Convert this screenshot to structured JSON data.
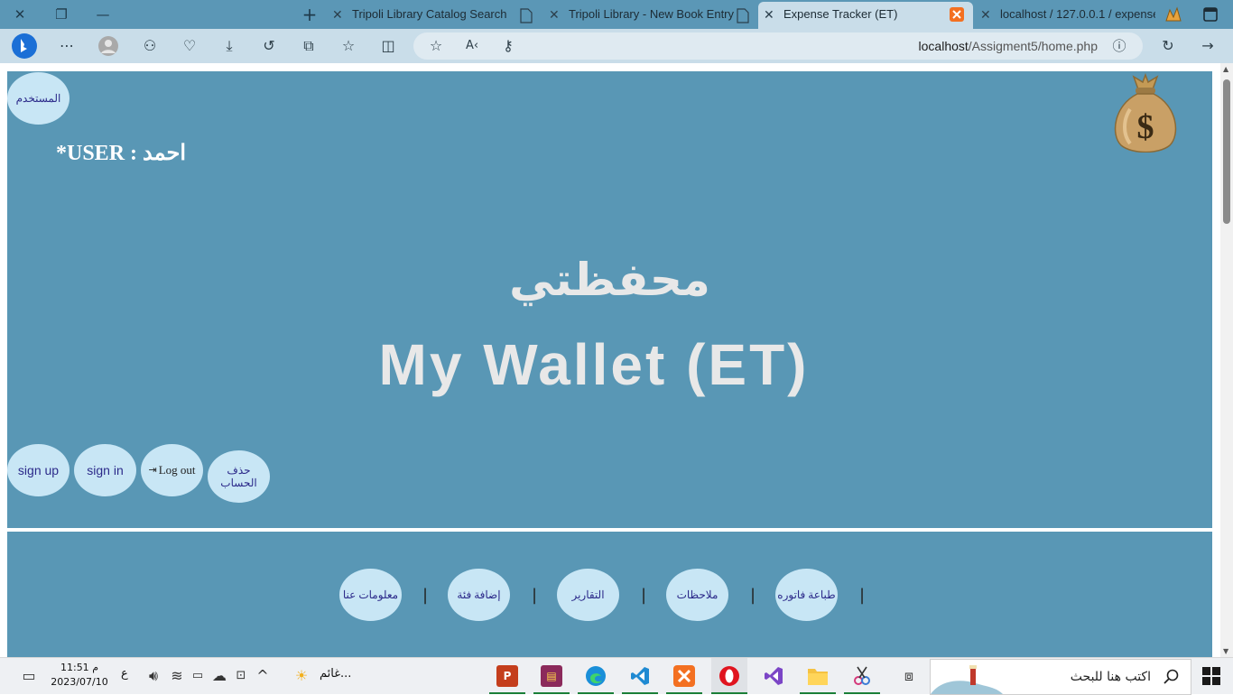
{
  "browser": {
    "tabs": [
      {
        "label": "Tripoli Library Catalog Search",
        "active": false
      },
      {
        "label": "Tripoli Library - New Book Entry",
        "active": false
      },
      {
        "label": "Expense Tracker (ET)",
        "active": true
      },
      {
        "label": "localhost / 127.0.0.1 / expenses",
        "active": false
      }
    ],
    "url_host": "localhost",
    "url_path": "/Assigment5/home.php"
  },
  "hero": {
    "user_button": "المستخدم",
    "user_label": "*USER : احمد",
    "wallet_ar": "محفظتي",
    "wallet_en": "My Wallet (ET)",
    "buttons": {
      "sign_up": "sign up",
      "sign_in": "sign in",
      "log_out": "Log out",
      "delete_account": "حذف الحساب"
    }
  },
  "footer": {
    "nav": [
      "معلومات عنا",
      "إضافة فئة",
      "التقارير",
      "ملاحظات",
      "طباعة فاتوره"
    ],
    "separator": "|"
  },
  "taskbar": {
    "time": "11:51 م",
    "date": "2023/07/10",
    "lang": "ع",
    "weather": "غائم...",
    "search_placeholder": "اكتب هنا للبحث"
  },
  "colors": {
    "page_bg": "#5997b5",
    "button_bg": "#c8e6f5",
    "button_text": "#2c2a8a",
    "titlebar": "#5b97b6",
    "toolbar": "#c9dde9"
  }
}
